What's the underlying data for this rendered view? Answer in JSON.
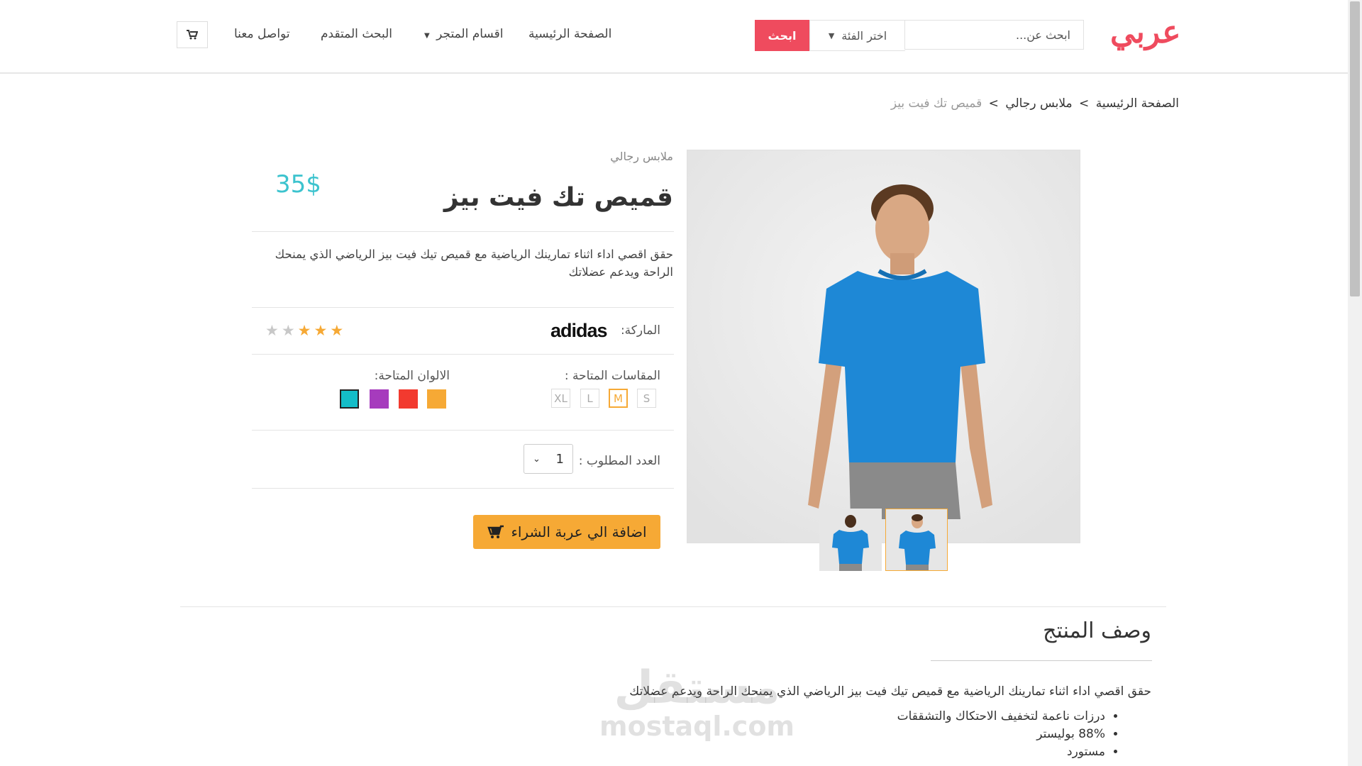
{
  "header": {
    "logo": "عربي",
    "search": {
      "placeholder": "ابحث عن...",
      "category_label": "اختر الفئة",
      "button_label": "ابحث"
    },
    "nav": {
      "home": "الصفحة الرئيسية",
      "sections": "اقسام المتجر",
      "advanced_search": "البحث المتقدم",
      "contact": "تواصل معنا"
    },
    "cart_icon": "shopping-cart-icon"
  },
  "breadcrumb": {
    "home": "الصفحة الرئيسية",
    "category": "ملابس رجالي",
    "current": "قميص تك فيت بيز",
    "separator": ">"
  },
  "product": {
    "category": "ملابس رجالي",
    "title": "قميص تك فيت بيز",
    "price": "35$",
    "short_description": "حقق اقصي اداء اثناء تمارينك الرياضية مع قميص تيك فيت بيز الرياضي الذي يمنحك الراحة ويدعم عضلاتك",
    "brand_label": "الماركة:",
    "brand_name": "adidas",
    "rating": 3,
    "rating_max": 5,
    "sizes_label": "المقاسات المتاحة :",
    "sizes": [
      "S",
      "M",
      "L",
      "XL"
    ],
    "selected_size": "M",
    "colors_label": "الالوان المتاحة:",
    "colors": [
      "#f6a935",
      "#f23a2f",
      "#a63bbd",
      "#14bdc8"
    ],
    "selected_color": "#14bdc8",
    "quantity_label": "العدد المطلوب :",
    "quantity": "1",
    "add_to_cart_label": "اضافة الي عربة الشراء",
    "accent_color": "#f6a935",
    "price_color": "#3cc3ce"
  },
  "description": {
    "title": "وصف المنتج",
    "text": "حقق اقصي اداء اثناء تمارينك الرياضية مع قميص تيك فيت بيز الرياضي الذي يمنحك الراحة ويدعم عضلاتك",
    "bullets": [
      "درزات ناعمة لتخفيف الاحتكاك والتشققات",
      "88% بوليستر",
      "مستورد"
    ]
  },
  "watermark": {
    "arabic": "مستقل",
    "latin": "mostaql.com"
  }
}
